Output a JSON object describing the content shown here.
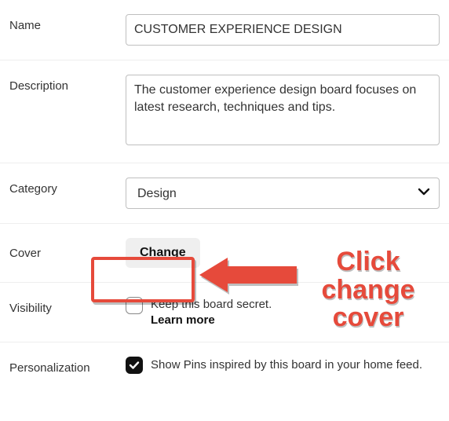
{
  "rows": {
    "name": {
      "label": "Name",
      "value": "CUSTOMER EXPERIENCE DESIGN"
    },
    "description": {
      "label": "Description",
      "value": "The customer experience design board focuses on latest research, techniques and tips."
    },
    "category": {
      "label": "Category",
      "selected": "Design"
    },
    "cover": {
      "label": "Cover",
      "button": "Change"
    },
    "visibility": {
      "label": "Visibility",
      "text": "Keep this board secret.",
      "learn_more": "Learn more",
      "checked": false
    },
    "personalization": {
      "label": "Personalization",
      "text": "Show Pins inspired by this board in your home feed.",
      "checked": true
    }
  },
  "annotation": {
    "line1": "Click",
    "line2": "change",
    "line3": "cover"
  }
}
